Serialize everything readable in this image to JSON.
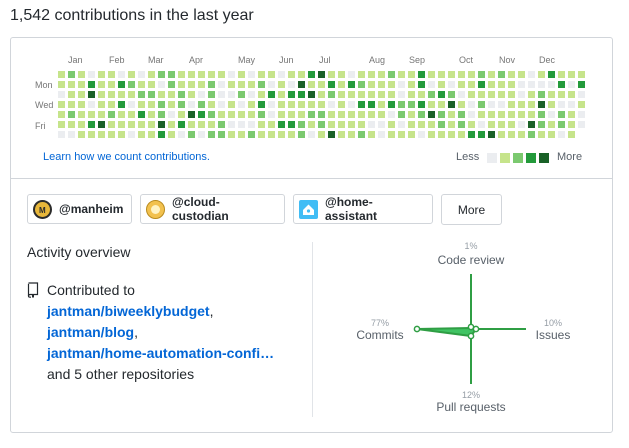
{
  "heading": "1,542 contributions in the last year",
  "calendar": {
    "months": [
      "Jan",
      "Feb",
      "Mar",
      "Apr",
      "May",
      "Jun",
      "Jul",
      "Aug",
      "Sep",
      "Oct",
      "Nov",
      "Dec"
    ],
    "days": [
      "Mon",
      "Wed",
      "Fri"
    ],
    "learn_link": "Learn how we count contributions.",
    "legend_less": "Less",
    "legend_more": "More",
    "colors": [
      "#ebedf0",
      "#c6e48b",
      "#7bc96f",
      "#239a3b",
      "#196127"
    ]
  },
  "orgs": [
    {
      "name": "@manheim",
      "avatar": "manheim-logo-icon"
    },
    {
      "name": "@cloud-custodian",
      "avatar": "cloud-custodian-logo-icon"
    },
    {
      "name": "@home-assistant",
      "avatar": "home-assistant-logo-icon"
    }
  ],
  "more_button": "More",
  "activity": {
    "title": "Activity overview",
    "contributed_to": "Contributed to",
    "repos": [
      "jantman/biweeklybudget",
      "jantman/blog",
      "jantman/home-automation-confi…"
    ],
    "others": "and 5 other repositories"
  },
  "radar": {
    "code_review": {
      "pct": "1%",
      "label": "Code review"
    },
    "issues": {
      "pct": "10%",
      "label": "Issues"
    },
    "pull_requests": {
      "pct": "12%",
      "label": "Pull requests"
    },
    "commits": {
      "pct": "77%",
      "label": "Commits"
    }
  }
}
